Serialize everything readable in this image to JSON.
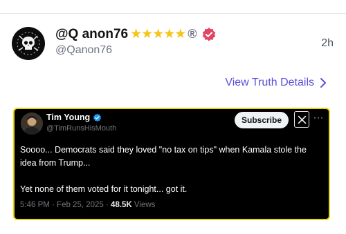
{
  "post": {
    "display_name": "@Q anon76",
    "stars": "★★★★★",
    "registered_mark": "®",
    "handle": "@Qanon76",
    "timestamp": "2h",
    "details_link": "View Truth Details"
  },
  "embed": {
    "author_name": "Tim Young",
    "author_handle": "@TimRunsHisMouth",
    "subscribe_label": "Subscribe",
    "more_glyph": "···",
    "text": "Soooo... Democrats said they loved \"no tax on tips\" when Kamala stole the idea from Trump...\n\nYet none of them voted for it tonight... got it.",
    "date": "5:46 PM · Feb 25, 2025 · ",
    "views_count": "48.5K",
    "views_label": " Views"
  },
  "colors": {
    "link": "#5b4fd6",
    "verified_truth": "#e24561",
    "verified_x": "#1d9bf0",
    "embed_border": "#e8d800",
    "stars": "#f5c518"
  },
  "icons": [
    "skull-avatar",
    "star-icon",
    "registered-icon",
    "verified-badge-icon",
    "chevron-right-icon",
    "x-logo-icon",
    "more-icon"
  ]
}
